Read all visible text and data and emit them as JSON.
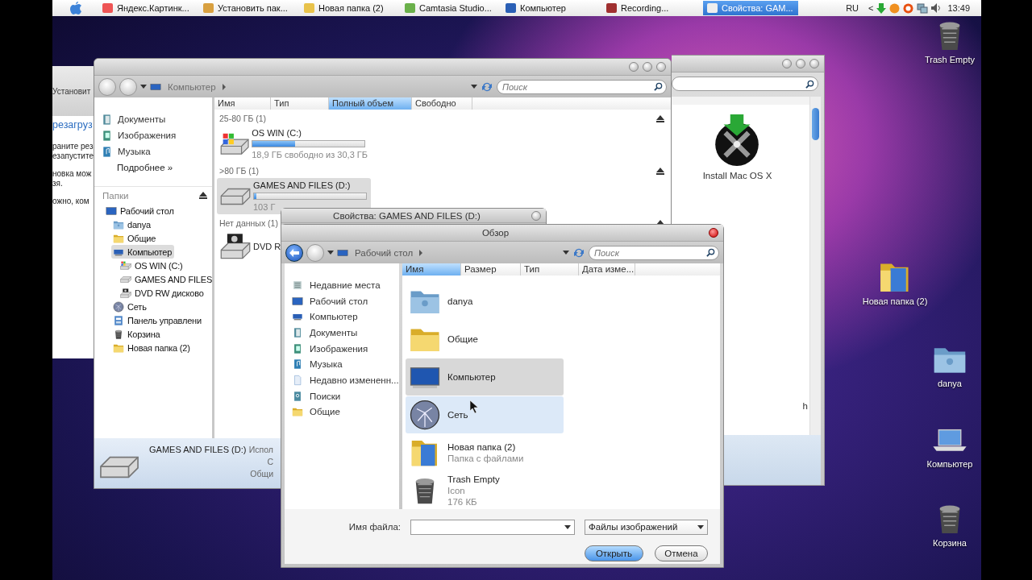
{
  "taskbar": {
    "tasks": [
      {
        "label": "Яндекс.Картинк...",
        "selected": false
      },
      {
        "label": "Установить пак...",
        "selected": false
      },
      {
        "label": "Новая папка (2)",
        "selected": false
      },
      {
        "label": "Camtasia Studio...",
        "selected": false
      },
      {
        "label": "Компьютер",
        "selected": false
      },
      {
        "label": "Recording...",
        "selected": false
      },
      {
        "label": "Свойства: GAM...",
        "selected": true
      }
    ],
    "language": "RU",
    "tray_arrow": "<",
    "clock": "13:49"
  },
  "desktop_icons": [
    {
      "label": "Trash Empty",
      "kind": "trash"
    },
    {
      "label": "Новая папка (2)",
      "kind": "media-folder"
    },
    {
      "label": "danya",
      "kind": "user-folder"
    },
    {
      "label": "Компьютер",
      "kind": "laptop"
    },
    {
      "label": "Корзина",
      "kind": "trash"
    }
  ],
  "installer_window": {
    "title": "Установит",
    "heading": "резагруз",
    "lines": [
      "раните рез",
      "езапустите",
      "новка мож",
      "зя.",
      "ожно, ком"
    ]
  },
  "back_window": {
    "items": [
      {
        "label": "Install Mac OS X",
        "kind": "disc"
      },
      {
        "label": "h",
        "kind": "partial"
      }
    ]
  },
  "explorer": {
    "back_enabled": false,
    "breadcrumb": "Компьютер",
    "search_placeholder": "Поиск",
    "favorites": [
      {
        "label": "Документы",
        "kind": "documents"
      },
      {
        "label": "Изображения",
        "kind": "pictures"
      },
      {
        "label": "Музыка",
        "kind": "music"
      }
    ],
    "more": "Подробнее »",
    "folders_header": "Папки",
    "tree": [
      {
        "label": "Рабочий стол",
        "kind": "desktop",
        "selected": false,
        "children": [
          {
            "label": "danya",
            "kind": "user-folder",
            "selected": false
          },
          {
            "label": "Общие",
            "kind": "folder",
            "selected": false
          },
          {
            "label": "Компьютер",
            "kind": "computer",
            "selected": true,
            "children": [
              {
                "label": "OS WIN  (C:)",
                "kind": "windows-drive",
                "selected": false
              },
              {
                "label": "GAMES AND FILES",
                "kind": "drive",
                "selected": false
              },
              {
                "label": "DVD RW дисково",
                "kind": "dvd",
                "selected": false
              }
            ]
          },
          {
            "label": "Сеть",
            "kind": "globe",
            "selected": false
          },
          {
            "label": "Панель управлени",
            "kind": "control-panel",
            "selected": false
          },
          {
            "label": "Корзина",
            "kind": "trash",
            "selected": false
          },
          {
            "label": "Новая папка (2)",
            "kind": "folder",
            "selected": false
          }
        ]
      }
    ],
    "columns": [
      {
        "label": "Имя",
        "selected": false
      },
      {
        "label": "Тип",
        "selected": false
      },
      {
        "label": "Полный объем",
        "selected": true
      },
      {
        "label": "Свободно",
        "selected": false
      }
    ],
    "groups": [
      {
        "header": "25-80 ГБ (1)",
        "drives": [
          {
            "name": "OS WIN  (C:)",
            "kind": "windows-drive",
            "selected": false,
            "level": 0.38,
            "free": "18,9 ГБ свободно из 30,3 ГБ"
          }
        ]
      },
      {
        "header": ">80 ГБ (1)",
        "drives": [
          {
            "name": "GAMES AND FILES (D:)",
            "kind": "drive",
            "selected": true,
            "level": 0.02,
            "free": "103 Г"
          }
        ]
      },
      {
        "header": "Нет данных (1)",
        "drives": [
          {
            "name": "DVD R",
            "kind": "dvd",
            "selected": false
          }
        ]
      }
    ],
    "details": {
      "name": "GAMES AND FILES (D:)",
      "lines": [
        "Испол",
        "С",
        "Общи"
      ]
    }
  },
  "properties_window": {
    "title": "Свойства: GAMES AND FILES (D:)"
  },
  "dialog": {
    "title": "Обзор",
    "back_enabled": true,
    "breadcrumb": "Рабочий стол",
    "search_placeholder": "Поиск",
    "nav": [
      {
        "label": "Недавние места",
        "kind": "recent"
      },
      {
        "label": "Рабочий стол",
        "kind": "desktop"
      },
      {
        "label": "Компьютер",
        "kind": "computer"
      },
      {
        "label": "Документы",
        "kind": "documents"
      },
      {
        "label": "Изображения",
        "kind": "pictures"
      },
      {
        "label": "Музыка",
        "kind": "music"
      },
      {
        "label": "Недавно измененн...",
        "kind": "recent-docs"
      },
      {
        "label": "Поиски",
        "kind": "searches"
      },
      {
        "label": "Общие",
        "kind": "folder"
      }
    ],
    "columns": [
      {
        "label": "Имя",
        "selected": true
      },
      {
        "label": "Размер",
        "selected": false
      },
      {
        "label": "Тип",
        "selected": false
      },
      {
        "label": "Дата изме...",
        "selected": false
      }
    ],
    "files": [
      {
        "name": "danya",
        "kind": "user-folder",
        "selected": false,
        "hovered": false
      },
      {
        "name": "Общие",
        "kind": "folder",
        "selected": false,
        "hovered": false
      },
      {
        "name": "Компьютер",
        "kind": "monitor",
        "selected": true,
        "hovered": false
      },
      {
        "name": "Сеть",
        "kind": "globe",
        "selected": false,
        "hovered": true
      },
      {
        "name": "Новая папка (2)",
        "kind": "media-folder",
        "details": [
          "Папка с файлами"
        ],
        "selected": false,
        "hovered": false
      },
      {
        "name": "Trash Empty",
        "kind": "trash",
        "details": [
          "Icon",
          "176 КБ"
        ],
        "selected": false,
        "hovered": false
      }
    ],
    "filename_label": "Имя файла:",
    "file_type": "Файлы изображений",
    "buttons": [
      {
        "label": "Открыть",
        "default": true
      },
      {
        "label": "Отмена",
        "default": false
      }
    ]
  }
}
